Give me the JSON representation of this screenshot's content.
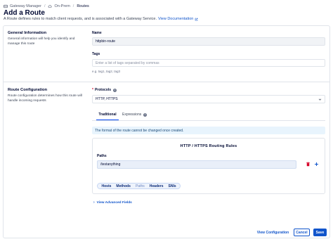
{
  "breadcrumbs": [
    {
      "label": "Gateway Manager",
      "icon": "gateway-icon"
    },
    {
      "label": "On-Prem",
      "icon": "cloud-icon"
    },
    {
      "label": "Routes"
    }
  ],
  "page": {
    "title": "Add a Route",
    "subtitle": "A Route defines rules to match client requests, and is associated with a Gateway Service.",
    "doc_link": "View Documentation"
  },
  "general": {
    "title": "General Information",
    "description": "General information will help you identify and manage this route",
    "name_label": "Name",
    "name_value": "httpbin-route",
    "tags_label": "Tags",
    "tags_placeholder": "Enter a list of tags separated by commas",
    "tags_help": "e.g. tag1, tag2, tag3"
  },
  "route_config": {
    "title": "Route Configuration",
    "description": "Route configuration determines how this route will handle incoming requests",
    "protocols_label": "Protocols",
    "protocols_value": "HTTP, HTTPS",
    "tabs": [
      {
        "label": "Traditional",
        "active": true
      },
      {
        "label": "Expressions",
        "active": false
      }
    ],
    "alert": "The format of the route cannot be changed once created.",
    "rules_title": "HTTP  /  HTTPS  Routing Rules",
    "paths_label": "Paths",
    "paths_value": "/testanything",
    "rule_pills": [
      {
        "label": "Hosts",
        "dim": false
      },
      {
        "label": "Methods",
        "dim": false
      },
      {
        "label": "Paths",
        "dim": true
      },
      {
        "label": "Headers",
        "dim": false
      },
      {
        "label": "SNIs",
        "dim": false
      }
    ],
    "advanced_link": "View Advanced Fields"
  },
  "footer": {
    "view_config": "View Configuration",
    "cancel": "Cancel",
    "save": "Save"
  },
  "colors": {
    "accent": "#1155cb",
    "tab_underline": "#0044f4",
    "alert_bg": "#e8f4fd",
    "delete": "#d60027"
  }
}
